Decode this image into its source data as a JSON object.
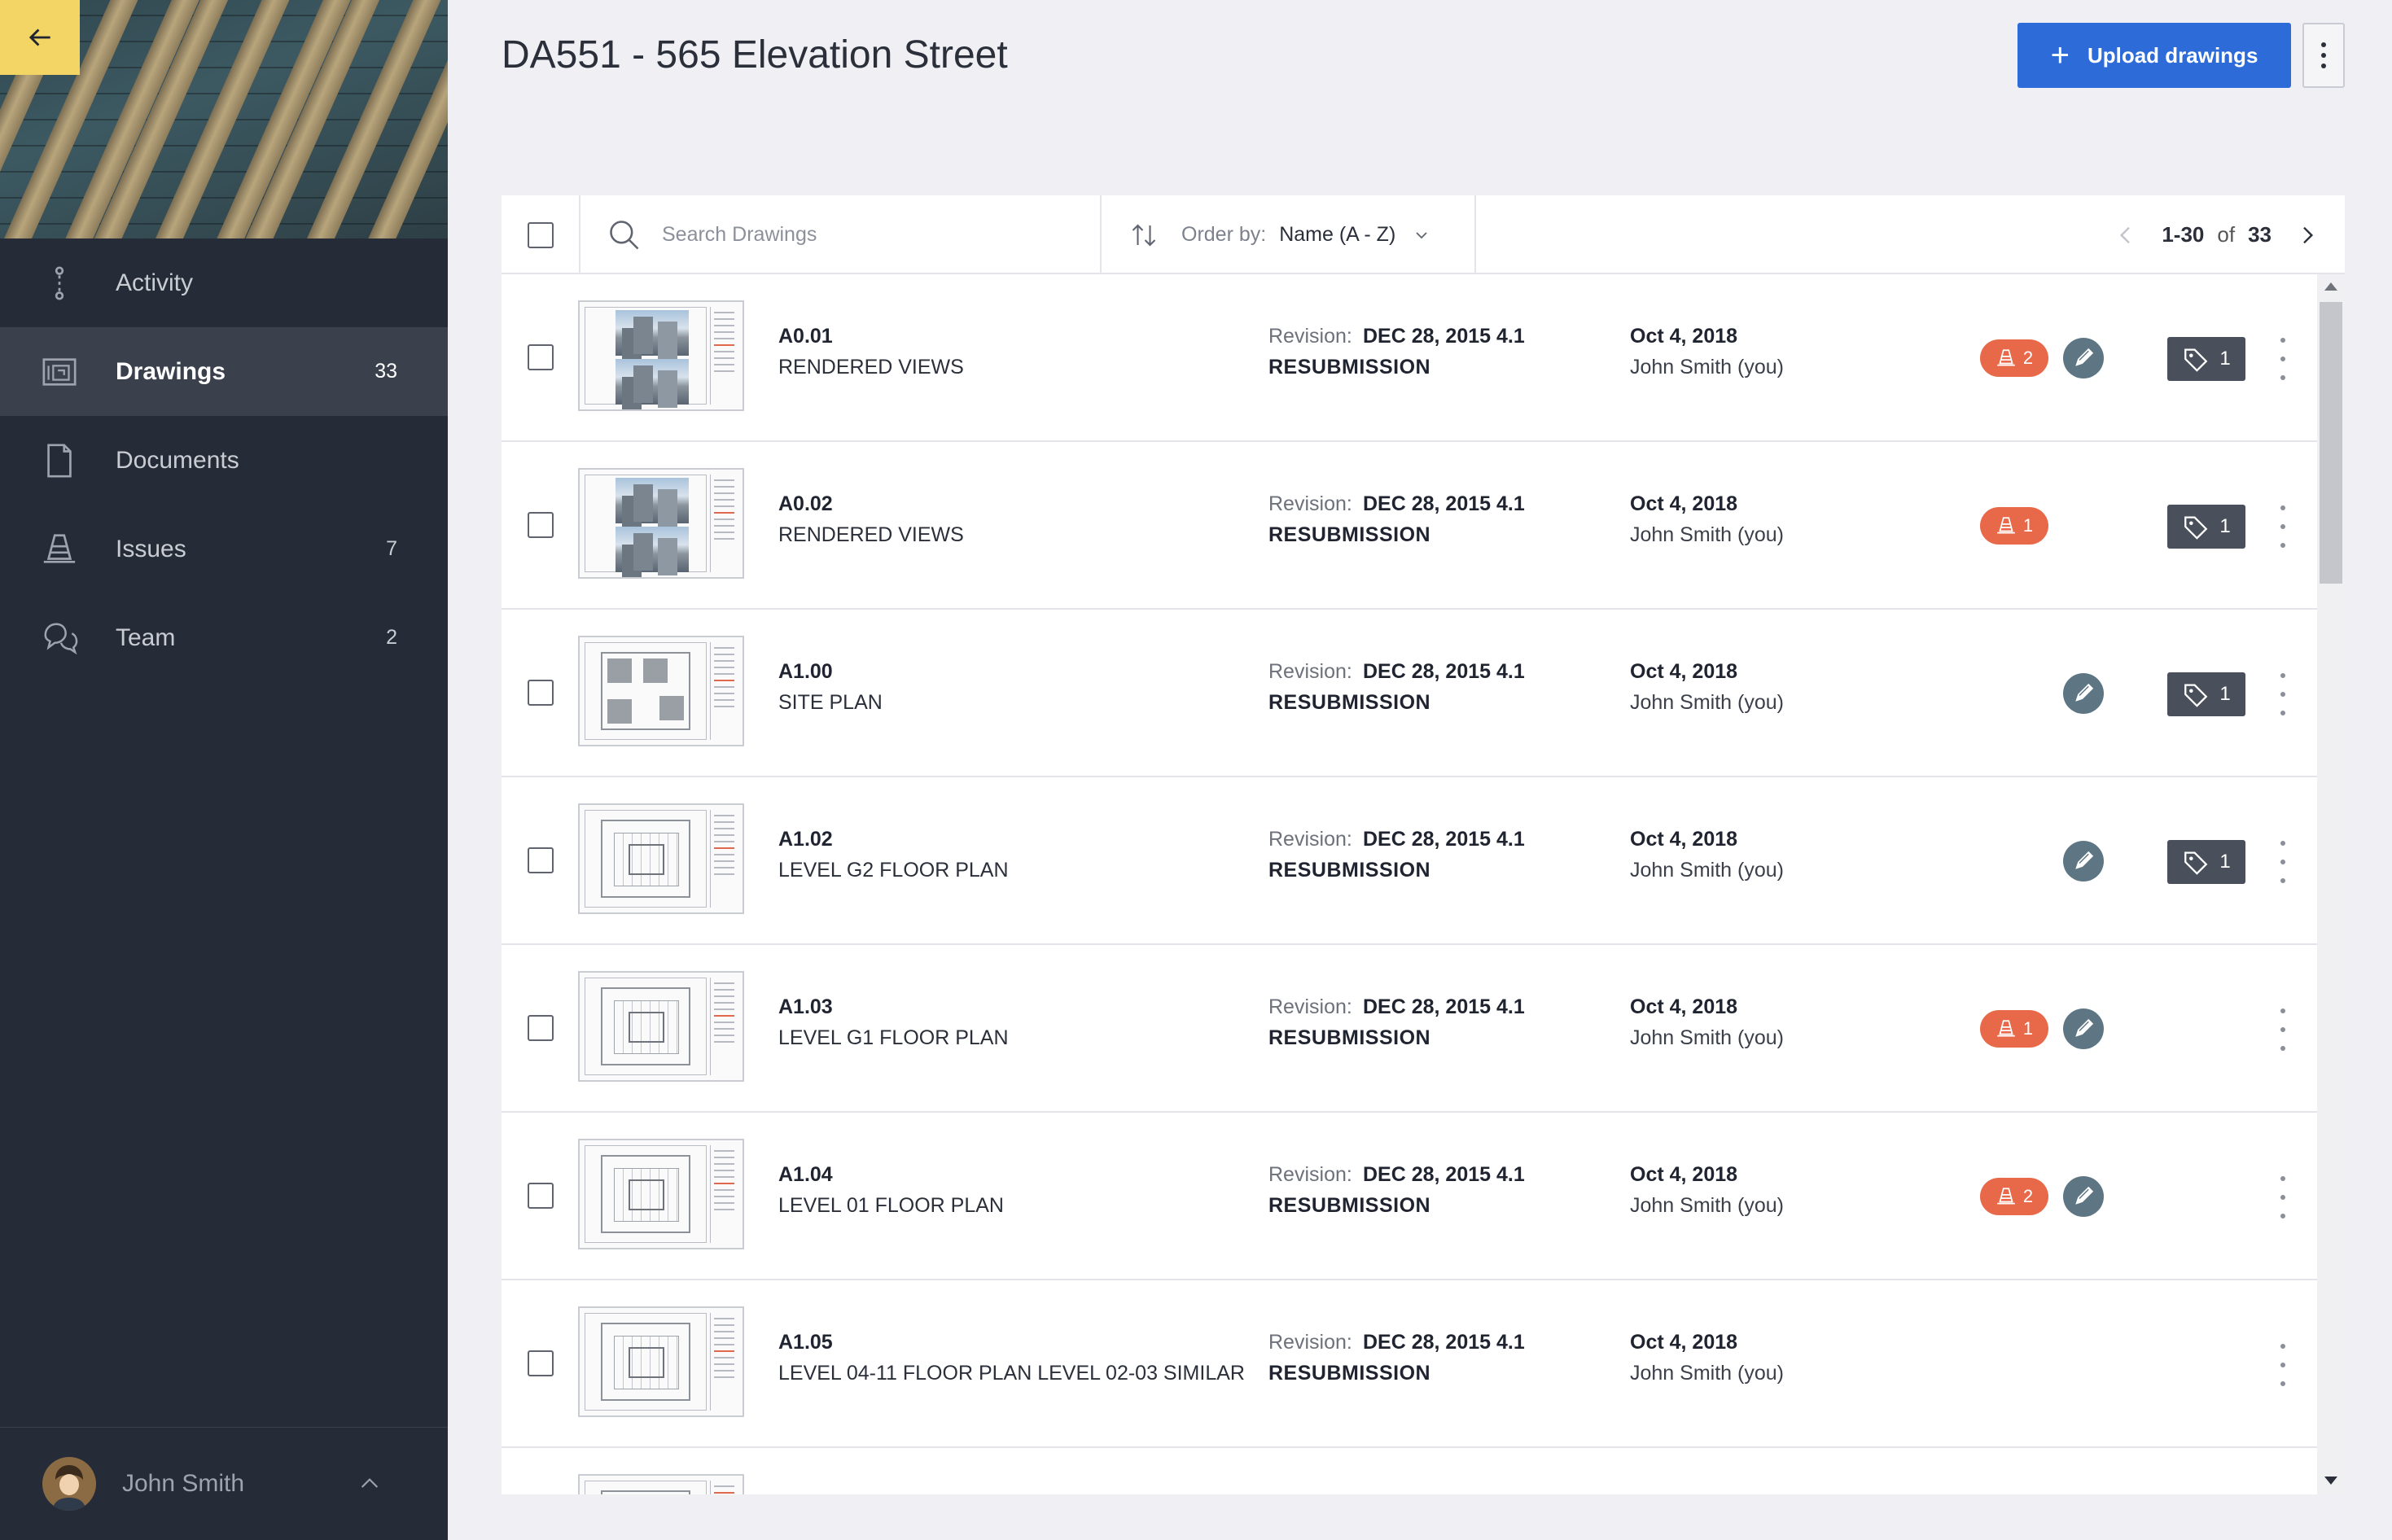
{
  "sidebar": {
    "nav": [
      {
        "label": "Activity",
        "count": "",
        "icon": "activity-icon",
        "active": false
      },
      {
        "label": "Drawings",
        "count": "33",
        "icon": "drawings-icon",
        "active": true
      },
      {
        "label": "Documents",
        "count": "",
        "icon": "document-icon",
        "active": false
      },
      {
        "label": "Issues",
        "count": "7",
        "icon": "cone-icon",
        "active": false
      },
      {
        "label": "Team",
        "count": "2",
        "icon": "team-icon",
        "active": false
      }
    ],
    "user": {
      "name": "John Smith"
    }
  },
  "header": {
    "title": "DA551 - 565 Elevation Street",
    "upload_plus": "+",
    "upload_label": "Upload drawings"
  },
  "toolbar": {
    "search_placeholder": "Search Drawings",
    "order_label": "Order by:",
    "order_value": "Name (A - Z)",
    "range": "1-30",
    "of": "of",
    "total": "33"
  },
  "rows": [
    {
      "code": "A0.01",
      "name": "RENDERED VIEWS",
      "rev_label": "Revision:",
      "rev_value": "DEC 28, 2015 4.1",
      "rev_status": "RESUBMISSION",
      "date": "Oct 4, 2018",
      "by": "John Smith (you)",
      "issues": "2",
      "markup": true,
      "tags": "1",
      "thumb": "photo"
    },
    {
      "code": "A0.02",
      "name": "RENDERED VIEWS",
      "rev_label": "Revision:",
      "rev_value": "DEC 28, 2015 4.1",
      "rev_status": "RESUBMISSION",
      "date": "Oct 4, 2018",
      "by": "John Smith (you)",
      "issues": "1",
      "markup": false,
      "tags": "1",
      "thumb": "photo"
    },
    {
      "code": "A1.00",
      "name": "SITE PLAN",
      "rev_label": "Revision:",
      "rev_value": "DEC 28, 2015 4.1",
      "rev_status": "RESUBMISSION",
      "date": "Oct 4, 2018",
      "by": "John Smith (you)",
      "issues": "",
      "markup": true,
      "tags": "1",
      "thumb": "site"
    },
    {
      "code": "A1.02",
      "name": "LEVEL G2 FLOOR PLAN",
      "rev_label": "Revision:",
      "rev_value": "DEC 28, 2015 4.1",
      "rev_status": "RESUBMISSION",
      "date": "Oct 4, 2018",
      "by": "John Smith (you)",
      "issues": "",
      "markup": true,
      "tags": "1",
      "thumb": "plan"
    },
    {
      "code": "A1.03",
      "name": "LEVEL G1 FLOOR PLAN",
      "rev_label": "Revision:",
      "rev_value": "DEC 28, 2015 4.1",
      "rev_status": "RESUBMISSION",
      "date": "Oct 4, 2018",
      "by": "John Smith (you)",
      "issues": "1",
      "markup": true,
      "tags": "",
      "thumb": "plan"
    },
    {
      "code": "A1.04",
      "name": "LEVEL 01 FLOOR PLAN",
      "rev_label": "Revision:",
      "rev_value": "DEC 28, 2015 4.1",
      "rev_status": "RESUBMISSION",
      "date": "Oct 4, 2018",
      "by": "John Smith (you)",
      "issues": "2",
      "markup": true,
      "tags": "",
      "thumb": "plan"
    },
    {
      "code": "A1.05",
      "name": "LEVEL 04-11 FLOOR PLAN LEVEL 02-03 SIMILAR",
      "rev_label": "Revision:",
      "rev_value": "DEC 28, 2015 4.1",
      "rev_status": "RESUBMISSION",
      "date": "Oct 4, 2018",
      "by": "John Smith (you)",
      "issues": "",
      "markup": false,
      "tags": "",
      "thumb": "plan"
    }
  ],
  "colors": {
    "accent": "#2d6bd8",
    "sidebar": "#262c37",
    "issue_badge": "#e8694a",
    "markup_badge": "#5e7683",
    "tag_badge": "#4a505b",
    "back_button": "#f2d564"
  }
}
